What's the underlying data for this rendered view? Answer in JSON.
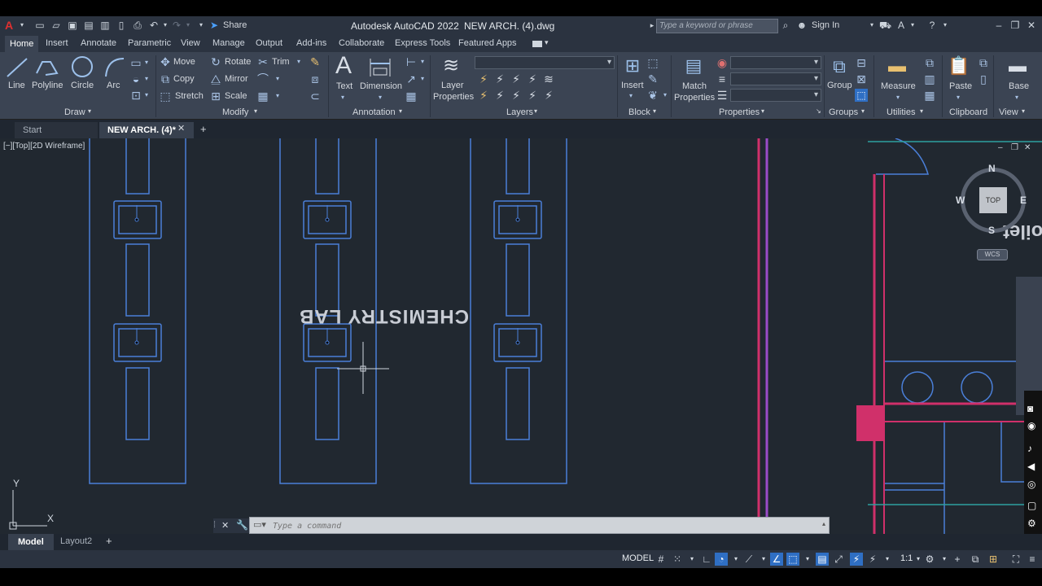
{
  "qat": {
    "share_label": "Share",
    "title": "Autodesk AutoCAD 2022",
    "file_name": "NEW ARCH. (4).dwg",
    "search_placeholder": "Type a keyword or phrase",
    "sign_in": "Sign In"
  },
  "menu": {
    "items": [
      "Home",
      "Insert",
      "Annotate",
      "Parametric",
      "View",
      "Manage",
      "Output",
      "Add-ins",
      "Collaborate",
      "Express Tools",
      "Featured Apps"
    ]
  },
  "ribbon": {
    "draw": {
      "title": "Draw",
      "line": "Line",
      "polyline": "Polyline",
      "circle": "Circle",
      "arc": "Arc"
    },
    "modify": {
      "title": "Modify",
      "move": "Move",
      "rotate": "Rotate",
      "trim": "Trim",
      "copy": "Copy",
      "mirror": "Mirror",
      "stretch": "Stretch",
      "scale": "Scale"
    },
    "annotation": {
      "title": "Annotation",
      "text": "Text",
      "dimension": "Dimension"
    },
    "layers": {
      "title": "Layers",
      "layer_properties_1": "Layer",
      "layer_properties_2": "Properties"
    },
    "block": {
      "title": "Block",
      "insert": "Insert"
    },
    "properties": {
      "title": "Properties",
      "match_1": "Match",
      "match_2": "Properties"
    },
    "groups": {
      "title": "Groups",
      "group": "Group"
    },
    "utilities": {
      "title": "Utilities",
      "measure": "Measure"
    },
    "clipboard": {
      "title": "Clipboard",
      "paste": "Paste"
    },
    "view": {
      "title": "View",
      "base": "Base"
    }
  },
  "doctabs": {
    "start": "Start",
    "active": "NEW ARCH. (4)*"
  },
  "viewport": {
    "label": "[−][Top][2D Wireframe]",
    "drawing_text": "CHEMISTRY LAB",
    "side_text": "oilet",
    "viewcube": {
      "n": "N",
      "s": "S",
      "e": "E",
      "w": "W",
      "top": "TOP",
      "wcs": "WCS"
    },
    "ucs": {
      "x": "X",
      "y": "Y"
    }
  },
  "command": {
    "placeholder": "Type a command"
  },
  "layouts": {
    "model": "Model",
    "layout2": "Layout2"
  },
  "status": {
    "model": "MODEL",
    "scale": "1:1"
  },
  "colors": {
    "accent": "#2f6fc4",
    "bg": "#212830",
    "lines": "#4a7fd8",
    "magenta": "#d0306a"
  }
}
